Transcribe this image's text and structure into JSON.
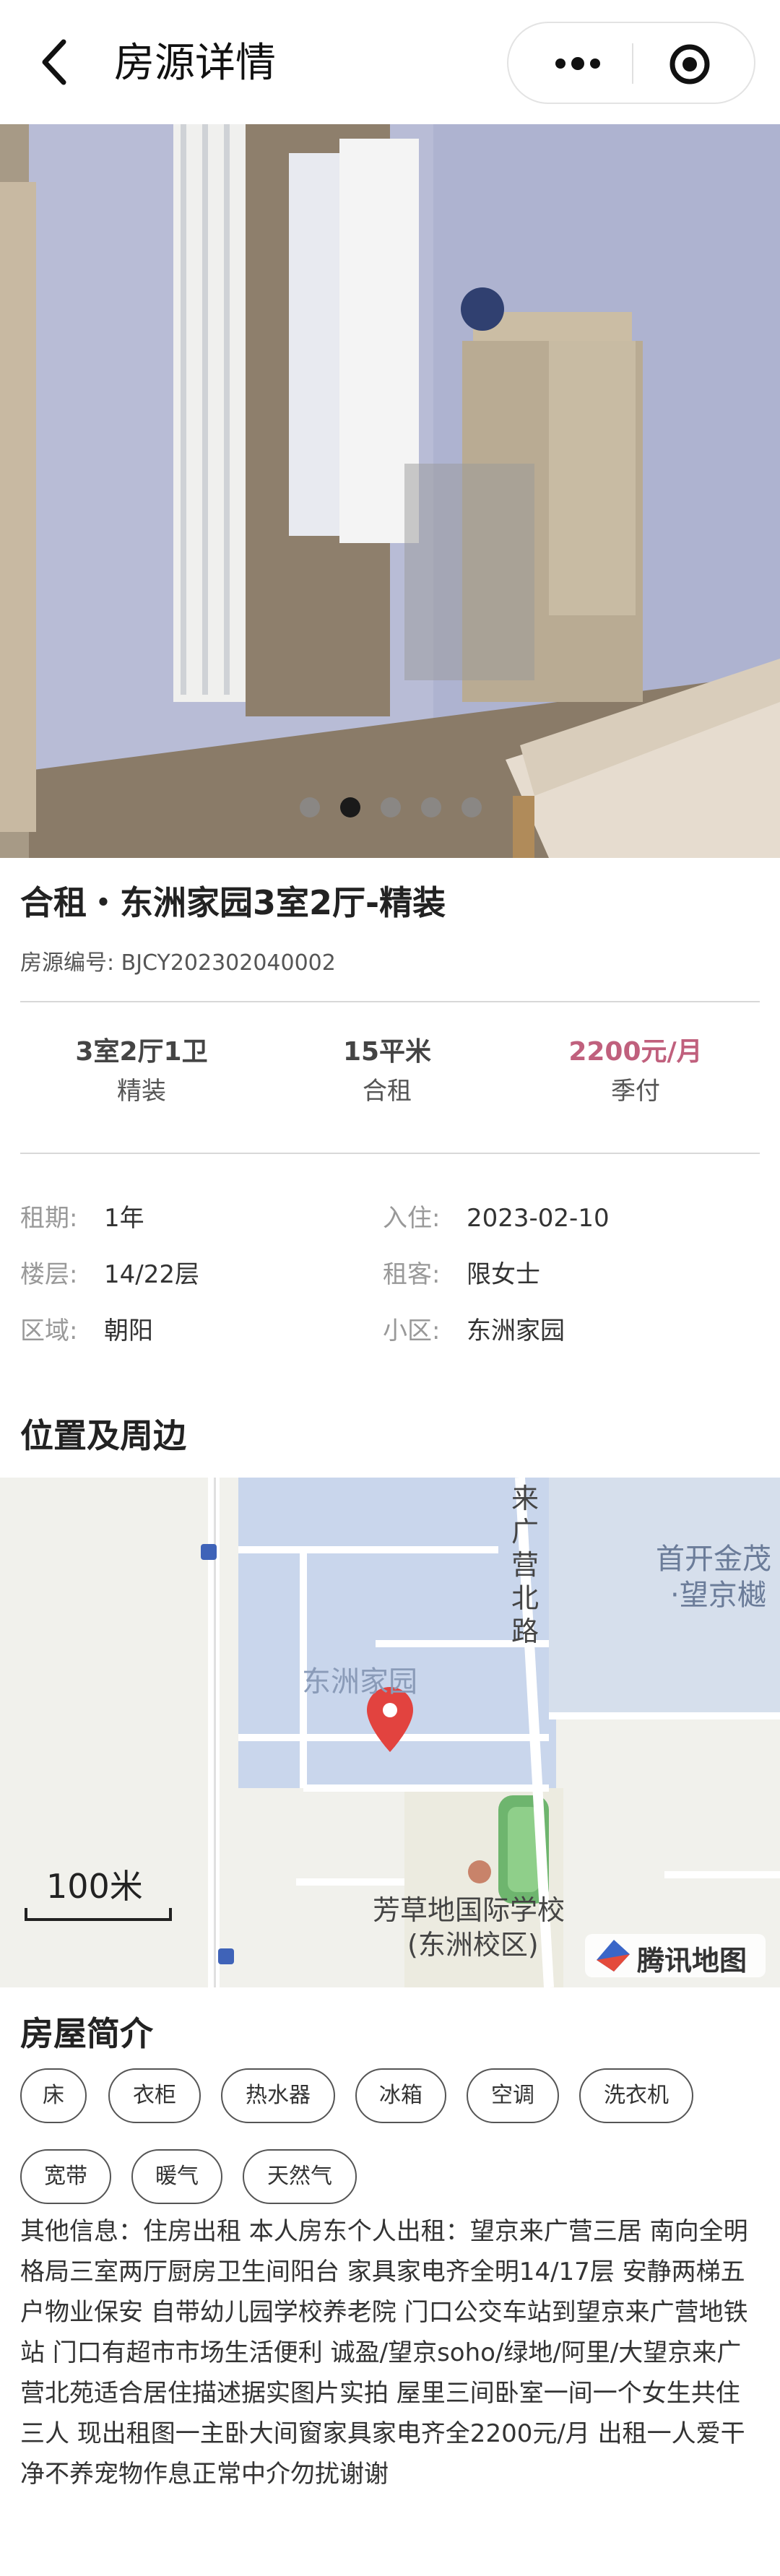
{
  "nav": {
    "title": "房源详情",
    "back_icon": "chevron-left-icon",
    "more_icon": "more-dots-icon",
    "target_icon": "target-icon"
  },
  "gallery": {
    "count": 5,
    "active_index": 1
  },
  "listing": {
    "title": "合租・东洲家园3室2厅-精装",
    "code": "房源编号: BJCY202302040002"
  },
  "stats": [
    {
      "top": "3室2厅1卫",
      "bottom": "精装"
    },
    {
      "top": "15平米",
      "bottom": "合租"
    },
    {
      "top": "2200元/月",
      "bottom": "季付"
    }
  ],
  "details": [
    {
      "key": "租期:",
      "value": "1年"
    },
    {
      "key": "入住:",
      "value": "2023-02-10"
    },
    {
      "key": "楼层:",
      "value": "14/22层"
    },
    {
      "key": "租客:",
      "value": "限女士"
    },
    {
      "key": "区域:",
      "value": "朝阳"
    },
    {
      "key": "小区:",
      "value": "东洲家园"
    }
  ],
  "location": {
    "heading": "位置及周边",
    "map_labels": {
      "road": "来广营北路",
      "poi_top": "首开金茂",
      "poi_top2": "·望京樾",
      "community": "东洲家园",
      "school1": "芳草地国际学校",
      "school2": "(东洲校区)",
      "scale": "100米",
      "provider": "腾讯地图"
    }
  },
  "intro": {
    "heading": "房屋简介",
    "tags": [
      "床",
      "衣柜",
      "热水器",
      "冰箱",
      "空调",
      "洗衣机",
      "宽带",
      "暖气",
      "天然气"
    ],
    "text": "其他信息：住房出租 本人房东个人出租：望京来广营三居 南向全明格局三室两厅厨房卫生间阳台 家具家电齐全明14/17层 安静两梯五户物业保安 自带幼儿园学校养老院 门口公交车站到望京来广营地铁站 门口有超市市场生活便利 诚盈/望京soho/绿地/阿里/大望京来广营北苑适合居住描述据实图片实拍 屋里三间卧室一间一个女生共住三人 现出租图一主卧大间窗家具家电齐全2200元/月 出租一人爱干净不养宠物作息正常中介勿扰谢谢"
  },
  "colors": {
    "price": "#c0607d",
    "divider": "#d8d8d8",
    "tag_border": "#555555"
  }
}
